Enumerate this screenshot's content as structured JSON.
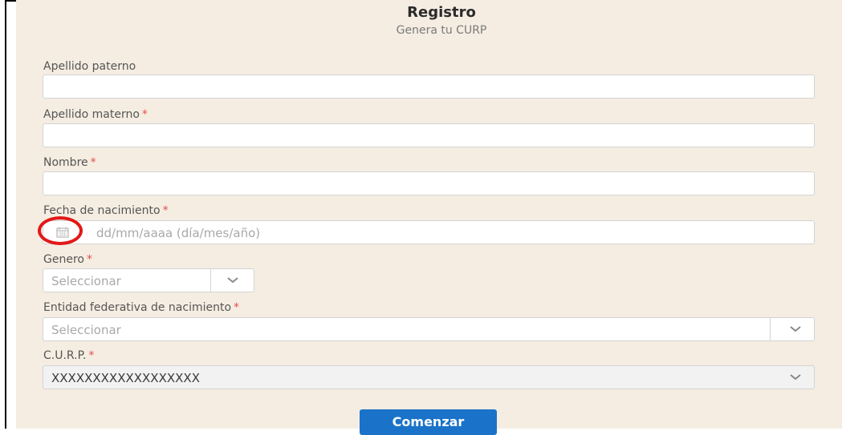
{
  "header": {
    "title": "Registro",
    "subtitle": "Genera tu CURP"
  },
  "form": {
    "apellido_paterno_label": "Apellido paterno",
    "apellido_materno_label": "Apellido materno",
    "nombre_label": "Nombre",
    "fecha_label": "Fecha de nacimiento",
    "fecha_placeholder": "dd/mm/aaaa (día/mes/año)",
    "genero_label": "Genero",
    "genero_value": "Seleccionar",
    "entidad_label": "Entidad federativa de nacimiento",
    "entidad_value": "Seleccionar",
    "curp_label": "C.U.R.P.",
    "curp_value": "XXXXXXXXXXXXXXXXXX",
    "required_marker": "*"
  },
  "actions": {
    "submit_label": "Comenzar"
  },
  "colors": {
    "panel_bg": "#f5ede2",
    "accent": "#1a73c9",
    "required": "#e2504b",
    "highlight_circle": "#e21818"
  },
  "icons": {
    "calendar": "calendar-icon",
    "chevron": "chevron-down-icon"
  }
}
